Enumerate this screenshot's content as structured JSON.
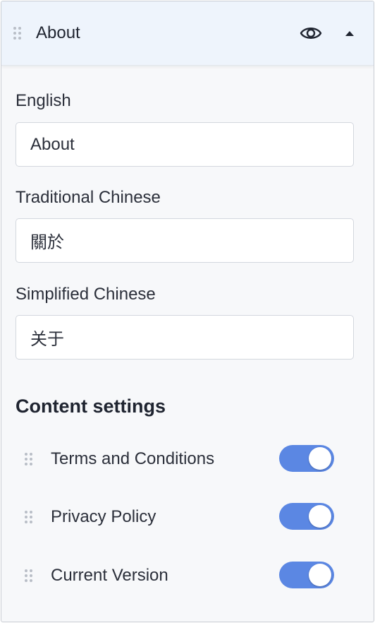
{
  "header": {
    "title": "About",
    "visibility_icon": "eye-icon",
    "collapse_icon": "caret-up-icon"
  },
  "fields": [
    {
      "label": "English",
      "value": "About"
    },
    {
      "label": "Traditional Chinese",
      "value": "關於"
    },
    {
      "label": "Simplified Chinese",
      "value": "关于"
    }
  ],
  "content_settings": {
    "title": "Content settings",
    "items": [
      {
        "label": "Terms and Conditions",
        "enabled": true
      },
      {
        "label": "Privacy Policy",
        "enabled": true
      },
      {
        "label": "Current Version",
        "enabled": true
      }
    ]
  },
  "colors": {
    "toggle_on": "#5b87e3",
    "header_bg": "#eef4fc",
    "panel_bg": "#f7f8fa"
  }
}
